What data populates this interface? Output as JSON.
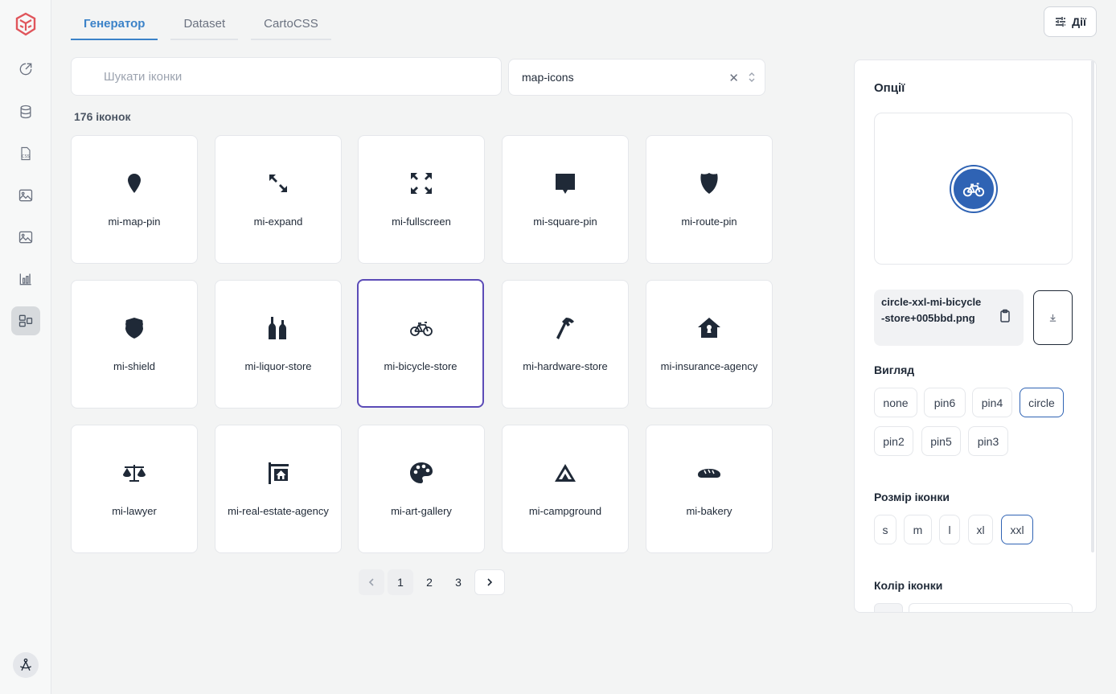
{
  "tabs": [
    {
      "label": "Генератор",
      "active": true
    },
    {
      "label": "Dataset",
      "active": false
    },
    {
      "label": "CartoCSS",
      "active": false
    }
  ],
  "actions": {
    "label": "Дії"
  },
  "search": {
    "placeholder": "Шукати іконки",
    "value": ""
  },
  "collection": {
    "value": "map-icons"
  },
  "count": "176 іконок",
  "icons": [
    {
      "name": "mi-map-pin"
    },
    {
      "name": "mi-expand"
    },
    {
      "name": "mi-fullscreen"
    },
    {
      "name": "mi-square-pin"
    },
    {
      "name": "mi-route-pin"
    },
    {
      "name": "mi-shield"
    },
    {
      "name": "mi-liquor-store"
    },
    {
      "name": "mi-bicycle-store"
    },
    {
      "name": "mi-hardware-store"
    },
    {
      "name": "mi-insurance-agency"
    },
    {
      "name": "mi-lawyer"
    },
    {
      "name": "mi-real-estate-agency"
    },
    {
      "name": "mi-art-gallery"
    },
    {
      "name": "mi-campground"
    },
    {
      "name": "mi-bakery"
    }
  ],
  "selected_icon": "mi-bicycle-store",
  "pagination": {
    "pages": [
      "1",
      "2",
      "3"
    ],
    "current": "1"
  },
  "options": {
    "title": "Опції",
    "filename": "circle-xxl-mi-bicycle-store+005bbd.png",
    "style_label": "Вигляд",
    "styles": [
      "none",
      "pin6",
      "pin4",
      "circle",
      "pin2",
      "pin5",
      "pin3"
    ],
    "selected_style": "circle",
    "size_label": "Розмір іконки",
    "sizes": [
      "s",
      "m",
      "l",
      "xl",
      "xxl"
    ],
    "selected_size": "xxl",
    "color_label": "Колір іконки",
    "icon_color": "#2f63b4"
  }
}
